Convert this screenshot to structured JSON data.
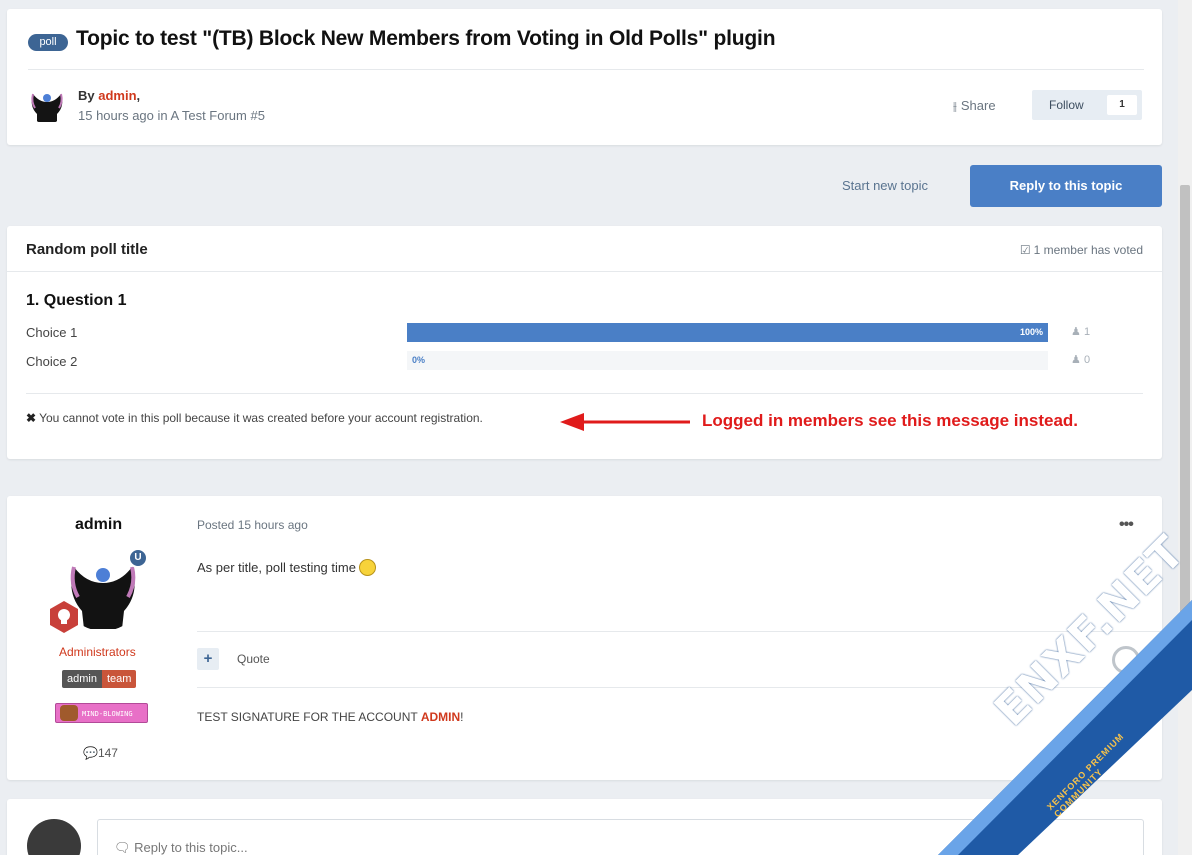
{
  "header": {
    "badge": "poll",
    "title": "Topic to test \"(TB) Block New Members from Voting in Old Polls\" plugin",
    "by_prefix": "By ",
    "author": "admin",
    "by_suffix": ",",
    "meta": "15 hours ago in A Test Forum #5",
    "share": "Share",
    "follow": "Follow",
    "follow_count": "1"
  },
  "actions": {
    "start_new": "Start new topic",
    "reply": "Reply to this topic"
  },
  "poll": {
    "title": "Random poll title",
    "voted": "1 member has voted",
    "question": "1. Question 1",
    "choices": [
      {
        "label": "Choice 1",
        "percent_label": "100%",
        "percent": 100,
        "votes": "1"
      },
      {
        "label": "Choice 2",
        "percent_label": "0%",
        "percent": 0,
        "votes": "0"
      }
    ],
    "cannot_vote": "You cannot vote in this poll because it was created before your account registration."
  },
  "annotation": {
    "text": "Logged in members see this message instead.",
    "color": "#e01b1b"
  },
  "post": {
    "author": "admin",
    "group": "Administrators",
    "badge_left": "admin",
    "badge_right": "team",
    "mind_badge": "MIND-BLOWING",
    "post_count": "147",
    "posted": "Posted 15 hours ago",
    "content": "As per title, poll testing time",
    "quote": "Quote",
    "signature_prefix": "TEST SIGNATURE FOR THE ACCOUNT ",
    "signature_name": "ADMIN",
    "signature_suffix": "!"
  },
  "reply_box": {
    "placeholder": "Reply to this topic..."
  },
  "watermark": {
    "main": "ENXF.NET",
    "sub": "XENFORO PREMIUM COMMUNITY"
  },
  "colors": {
    "accent": "#4a7fc6",
    "author_red": "#d0391d",
    "badge_blue": "#3d6594"
  }
}
